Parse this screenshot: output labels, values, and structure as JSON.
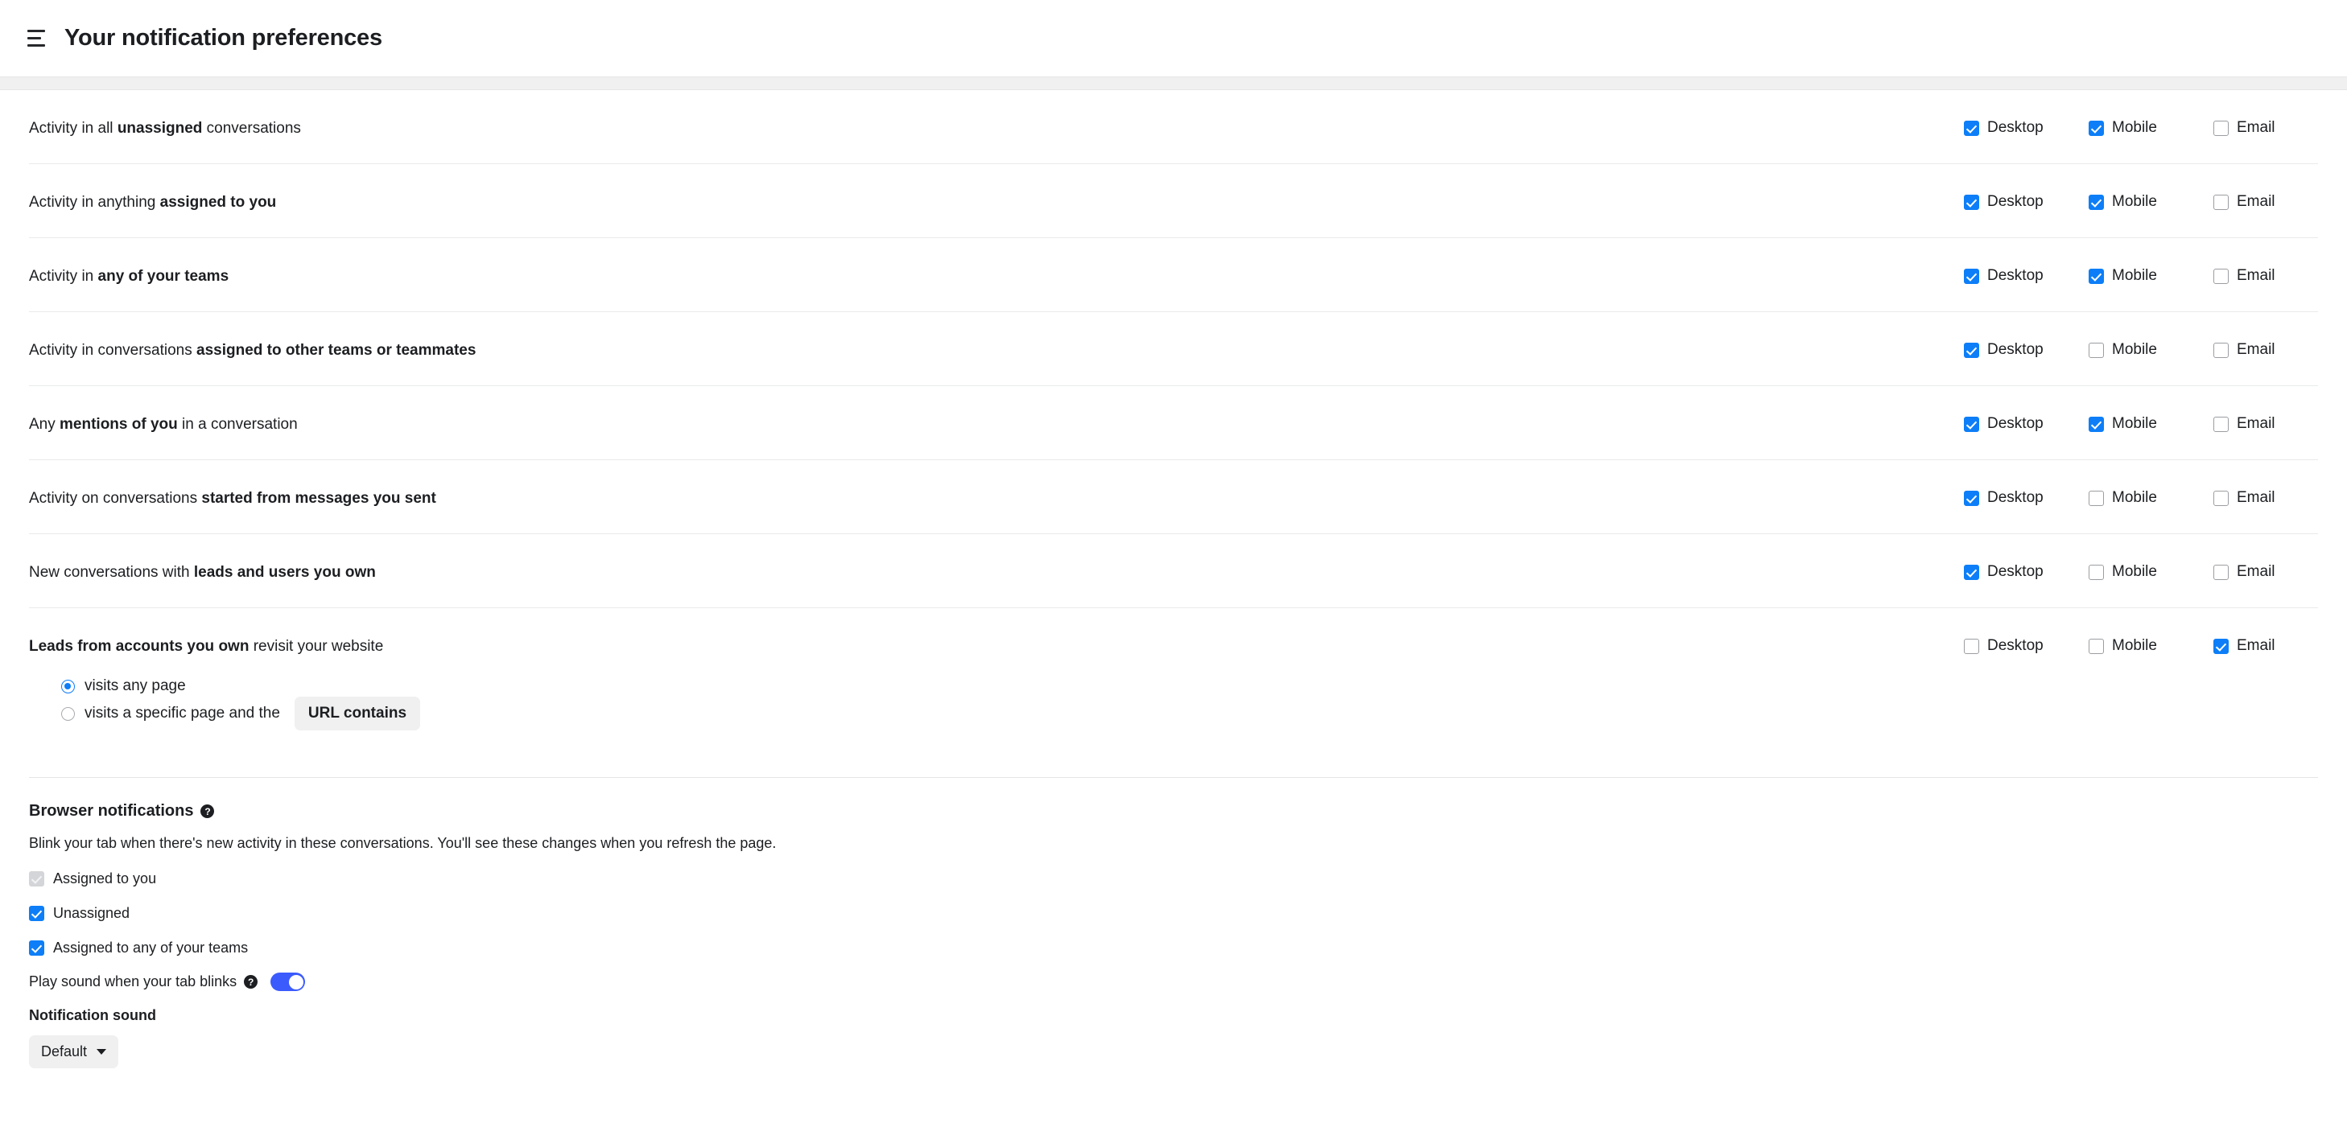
{
  "header": {
    "title": "Your notification preferences",
    "menu_icon": "hamburger-menu-icon"
  },
  "channels": {
    "desktop": "Desktop",
    "mobile": "Mobile",
    "email": "Email"
  },
  "notification_rows": [
    {
      "prefix": "Activity in all ",
      "bold": "unassigned",
      "suffix": " conversations",
      "desktop": true,
      "mobile": true,
      "email": false
    },
    {
      "prefix": "Activity in anything ",
      "bold": "assigned to you",
      "suffix": "",
      "desktop": true,
      "mobile": true,
      "email": false
    },
    {
      "prefix": "Activity in ",
      "bold": "any of your teams",
      "suffix": "",
      "desktop": true,
      "mobile": true,
      "email": false
    },
    {
      "prefix": "Activity in conversations ",
      "bold": "assigned to other teams or teammates",
      "suffix": "",
      "desktop": true,
      "mobile": false,
      "email": false
    },
    {
      "prefix": "Any ",
      "bold": "mentions of you",
      "suffix": " in a conversation",
      "desktop": true,
      "mobile": true,
      "email": false
    },
    {
      "prefix": "Activity on conversations ",
      "bold": "started from messages you sent",
      "suffix": "",
      "desktop": true,
      "mobile": false,
      "email": false
    },
    {
      "prefix": "New conversations with ",
      "bold": "leads and users you own",
      "suffix": "",
      "desktop": true,
      "mobile": false,
      "email": false
    },
    {
      "prefix": "",
      "bold": "Leads from accounts you own",
      "suffix": " revisit your website",
      "desktop": false,
      "mobile": false,
      "email": true
    }
  ],
  "leads_options": {
    "any_page_label": "visits any page",
    "any_page_selected": true,
    "specific_page_label": "visits a specific page and the",
    "specific_page_selected": false,
    "url_button_label": "URL contains"
  },
  "browser_notifications": {
    "title": "Browser notifications",
    "help_icon": "help-circle-icon",
    "description": "Blink your tab when there's new activity in these conversations. You'll see these changes when you refresh the page.",
    "options": [
      {
        "label": "Assigned to you",
        "checked": true,
        "disabled": true
      },
      {
        "label": "Unassigned",
        "checked": true,
        "disabled": false
      },
      {
        "label": "Assigned to any of your teams",
        "checked": true,
        "disabled": false
      }
    ],
    "play_sound_label": "Play sound when your tab blinks",
    "play_sound_help_icon": "help-circle-icon",
    "play_sound_on": true,
    "notification_sound_title": "Notification sound",
    "notification_sound_value": "Default",
    "notification_sound_caret": "chevron-down-icon"
  },
  "colors": {
    "accent_checkbox": "#0d7ef7",
    "accent_toggle": "#3b5bfd",
    "disabled_checkbox": "#d3d5d8",
    "divider": "#e9eaea",
    "band": "#f0f0f0"
  }
}
